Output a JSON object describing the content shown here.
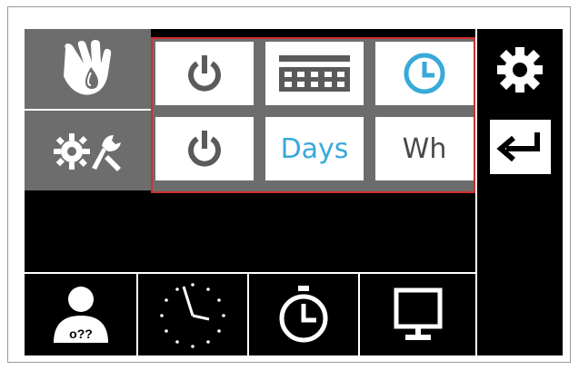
{
  "control_panel": {
    "side_menu": [
      {
        "icon": "hand-water-drop-icon"
      },
      {
        "icon": "gear-tools-icon"
      }
    ],
    "highlighted_buttons": [
      [
        {
          "icon": "power-icon",
          "color": "#5a5a5a"
        },
        {
          "icon": "keypad-grid-icon",
          "color": "#5a5a5a"
        },
        {
          "icon": "clock-icon",
          "color": "#38a9d9"
        }
      ],
      [
        {
          "icon": "power-icon",
          "color": "#5a5a5a"
        },
        {
          "label": "Days",
          "color": "#38a9d9"
        },
        {
          "label": "Wh",
          "color": "#4a4a4a"
        }
      ]
    ],
    "right_panel": {
      "settings_icon": "gear-icon",
      "enter_icon": "enter-arrow-icon"
    },
    "bottom_bar": [
      {
        "icon": "user-icon",
        "badge": "o??"
      },
      {
        "icon": "analog-clock-icon"
      },
      {
        "icon": "timer-icon"
      },
      {
        "icon": "monitor-icon"
      }
    ],
    "colors": {
      "background": "#000000",
      "side_panel": "#6d6d6d",
      "highlight_border": "#cf2f2f",
      "accent_blue": "#38a9d9"
    }
  }
}
